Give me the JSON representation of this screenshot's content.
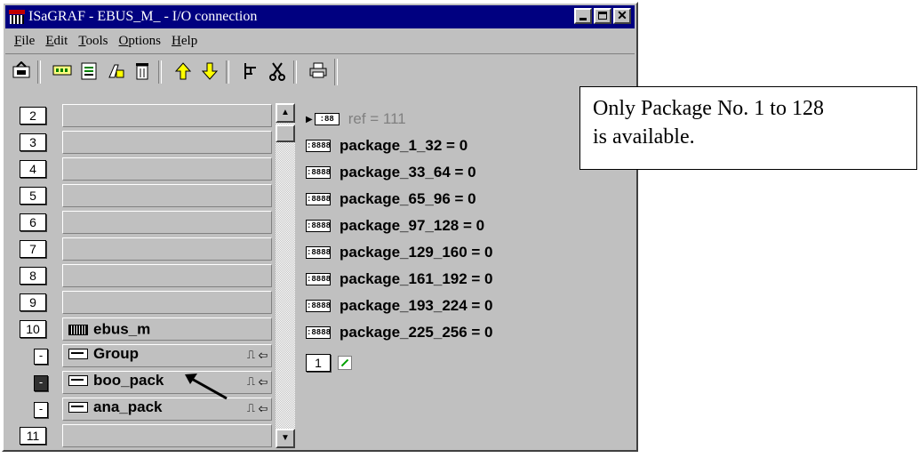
{
  "window": {
    "title": "ISaGRAF - EBUS_M_ - I/O connection"
  },
  "menu": {
    "items": [
      {
        "label": "File",
        "key": "F"
      },
      {
        "label": "Edit",
        "key": "E"
      },
      {
        "label": "Tools",
        "key": "T"
      },
      {
        "label": "Options",
        "key": "O"
      },
      {
        "label": "Help",
        "key": "H"
      }
    ]
  },
  "toolbar": {
    "icons": [
      "save-icon",
      "connect-board-icon",
      "board-list-icon",
      "open-board-icon",
      "delete-icon",
      "move-up-icon",
      "move-down-icon",
      "tree-icon",
      "cut-icon",
      "print-icon"
    ]
  },
  "slots": [
    {
      "num": "2",
      "label": ""
    },
    {
      "num": "3",
      "label": ""
    },
    {
      "num": "4",
      "label": ""
    },
    {
      "num": "5",
      "label": ""
    },
    {
      "num": "6",
      "label": ""
    },
    {
      "num": "7",
      "label": ""
    },
    {
      "num": "8",
      "label": ""
    },
    {
      "num": "9",
      "label": ""
    },
    {
      "num": "10",
      "label": "ebus_m"
    }
  ],
  "subitems": [
    {
      "btn": "-",
      "label": "Group",
      "signal": "⎍ ⇦"
    },
    {
      "btn": "-",
      "label": "boo_pack",
      "signal": "⎍ ⇦"
    },
    {
      "btn": "-",
      "label": "ana_pack",
      "signal": "⎍ ⇦"
    }
  ],
  "last_slot": {
    "num": "11",
    "label": ""
  },
  "variables": [
    {
      "icon": ":88",
      "text": "ref = 111",
      "greyed": true
    },
    {
      "icon": ":8888",
      "text": "package_1_32 = 0"
    },
    {
      "icon": ":8888",
      "text": "package_33_64 = 0"
    },
    {
      "icon": ":8888",
      "text": "package_65_96 = 0"
    },
    {
      "icon": ":8888",
      "text": "package_97_128 = 0"
    },
    {
      "icon": ":8888",
      "text": "package_129_160 = 0"
    },
    {
      "icon": ":8888",
      "text": "package_161_192 = 0"
    },
    {
      "icon": ":8888",
      "text": "package_193_224 = 0"
    },
    {
      "icon": ":8888",
      "text": "package_225_256 = 0"
    }
  ],
  "page_button": "1",
  "annotation": {
    "line1": "Only Package No. 1 to 128",
    "line2": "is available."
  }
}
